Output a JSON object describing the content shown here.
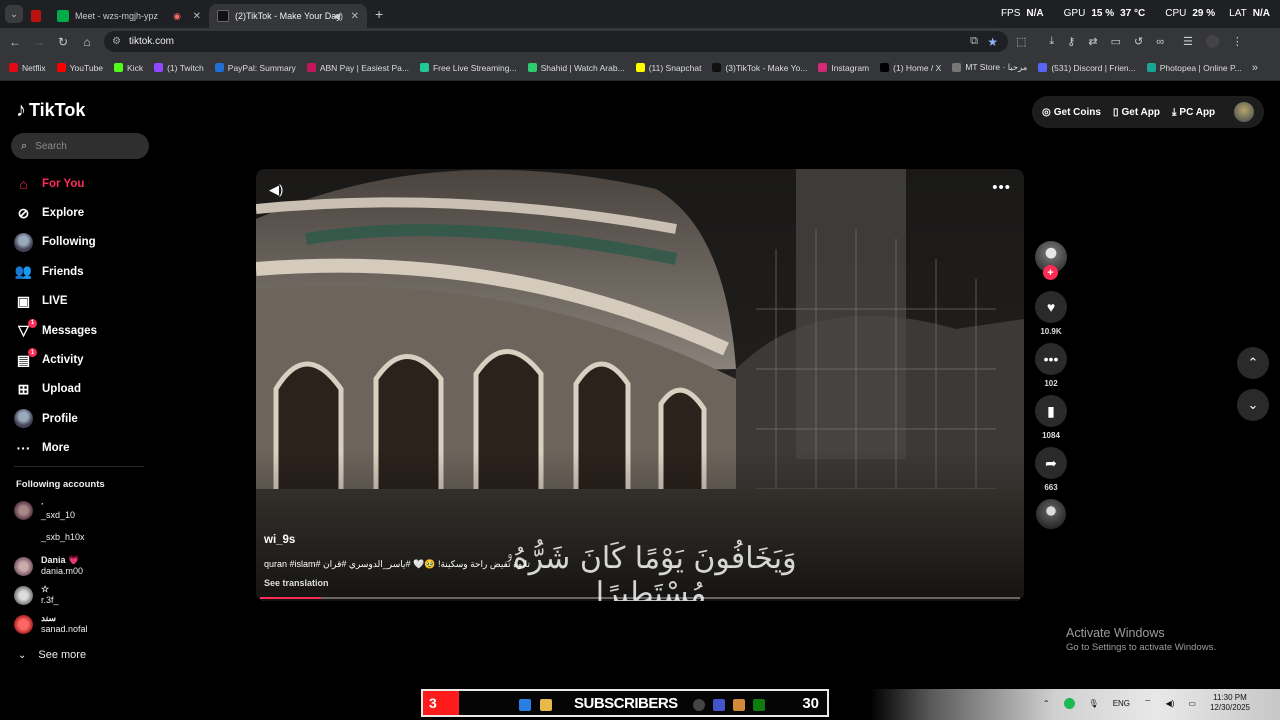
{
  "browser": {
    "tabs": [
      {
        "label": "",
        "active": false
      },
      {
        "label": "Meet - wzs-mgjh-ypz",
        "active": false
      },
      {
        "label": "(2)TikTok - Make Your Day",
        "active": true
      }
    ],
    "new_tab": "+",
    "address": "tiktok.com",
    "perf": {
      "fps_label": "FPS",
      "fps_value": "N/A",
      "gpu_label": "GPU",
      "gpu_value": "15 %",
      "gpu_temp": "37 °C",
      "cpu_label": "CPU",
      "cpu_value": "29 %",
      "lat_label": "LAT",
      "lat_value": "N/A"
    },
    "bookmarks": [
      {
        "label": "Netflix",
        "color": "#e50914"
      },
      {
        "label": "YouTube",
        "color": "#ff0000"
      },
      {
        "label": "Kick",
        "color": "#53fc18"
      },
      {
        "label": "(1) Twitch",
        "color": "#9146ff"
      },
      {
        "label": "PayPal: Summary",
        "color": "#1f6fd1"
      },
      {
        "label": "ABN Pay | Easiest Pa...",
        "color": "#c2185b"
      },
      {
        "label": "Free Live Streaming...",
        "color": "#20c997"
      },
      {
        "label": "Shahid | Watch Arab...",
        "color": "#2ecc71"
      },
      {
        "label": "(11) Snapchat",
        "color": "#fffc00"
      },
      {
        "label": "(3)TikTok - Make Yo...",
        "color": "#111111"
      },
      {
        "label": "Instagram",
        "color": "#d62976"
      },
      {
        "label": "(1) Home / X",
        "color": "#000000"
      },
      {
        "label": "MT Store · مرحبا",
        "color": "#777777"
      },
      {
        "label": "(531) Discord | Frien...",
        "color": "#5865f2"
      },
      {
        "label": "Photopea | Online P...",
        "color": "#18a497"
      }
    ]
  },
  "tiktok": {
    "logo": "TikTok",
    "search_placeholder": "Search",
    "nav": [
      {
        "label": "For You",
        "icon": "home-icon",
        "active": true
      },
      {
        "label": "Explore",
        "icon": "compass-icon"
      },
      {
        "label": "Following",
        "icon": "following-avatar-icon"
      },
      {
        "label": "Friends",
        "icon": "friends-icon"
      },
      {
        "label": "LIVE",
        "icon": "live-icon"
      },
      {
        "label": "Messages",
        "icon": "messages-icon",
        "badge": "1"
      },
      {
        "label": "Activity",
        "icon": "activity-icon",
        "badge": "1"
      },
      {
        "label": "Upload",
        "icon": "upload-icon"
      },
      {
        "label": "Profile",
        "icon": "profile-avatar-icon"
      },
      {
        "label": "More",
        "icon": "more-icon"
      }
    ],
    "following_title": "Following accounts",
    "accounts": [
      {
        "display": "·",
        "username": "_sxd_10"
      },
      {
        "display": "",
        "username": "_sxb_h10x"
      },
      {
        "display": "Dania 💗",
        "username": "dania.m00"
      },
      {
        "display": "☆",
        "username": "r.3f_"
      },
      {
        "display": "سند",
        "username": "sanad.nofal"
      }
    ],
    "see_more": "See more",
    "top_right": {
      "coins": "Get Coins",
      "app": "Get App",
      "pc_app": "PC App"
    },
    "video": {
      "username": "wi_9s",
      "caption": "تلاوة تفيض راحة وسكينة! 🥹🤍 #ياسر_الدوسري #قران #quran #islam",
      "see_translation": "See translation",
      "overlay_arabic": "وَيَخَافُونَ يَوْمًا كَانَ شَرُّهُۥ مُسْتَطِيرًا",
      "progress": 0.08
    },
    "actions": {
      "likes": "10.9K",
      "comments": "102",
      "saves": "1084",
      "shares": "663"
    }
  },
  "windows": {
    "activate_title": "Activate Windows",
    "activate_sub": "Go to Settings to activate Windows.",
    "subs_number": "3",
    "subs_label": "SUBSCRIBERS",
    "subs_count": "30",
    "lang": "ENG",
    "time": "11:30 PM",
    "date": "12/30/2025"
  }
}
